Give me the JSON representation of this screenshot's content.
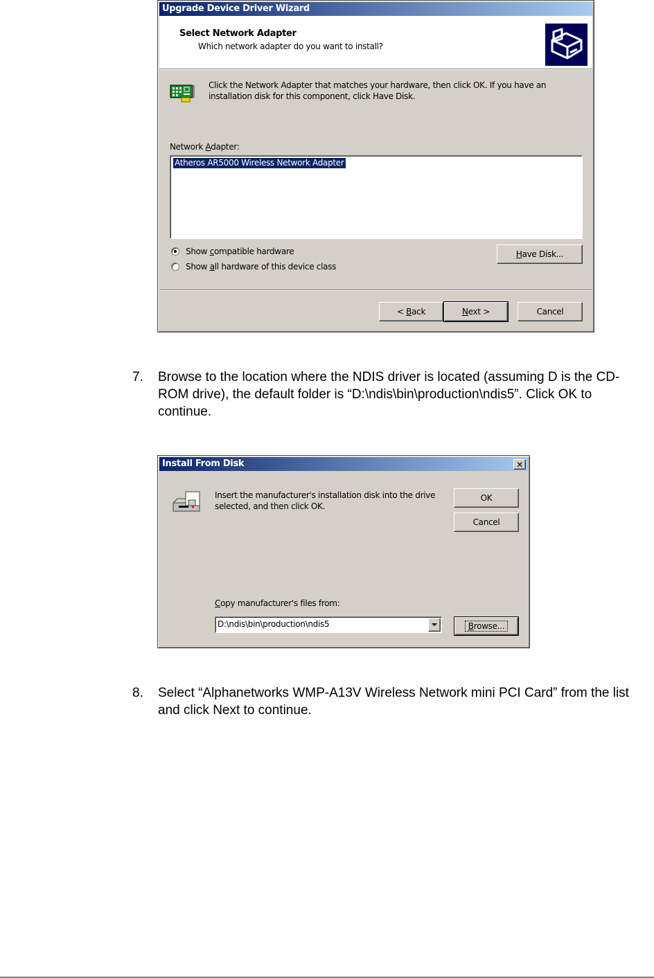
{
  "wizard": {
    "title": "Upgrade Device Driver Wizard",
    "header_title": "Select Network Adapter",
    "header_subtitle": "Which network adapter do you want to install?",
    "header_icon": "hardware-drawer-icon",
    "instruction": "Click the Network Adapter that matches your hardware, then click OK. If you have an installation disk for this component, click Have Disk.",
    "instruction_icon": "network-card-icon",
    "list_label_prefix": "Network ",
    "list_label_accel": "A",
    "list_label_suffix": "dapter:",
    "list_items": [
      {
        "label": "Atheros AR5000 Wireless Network Adapter",
        "selected": true
      }
    ],
    "radio_options": [
      {
        "prefix": "Show ",
        "accel": "c",
        "suffix": "ompatible hardware",
        "checked": true
      },
      {
        "prefix": "Show ",
        "accel": "a",
        "suffix": "ll hardware of this device class",
        "checked": false
      }
    ],
    "have_disk": {
      "accel": "H",
      "rest": "ave Disk..."
    },
    "back": {
      "prefix": "< ",
      "accel": "B",
      "rest": "ack"
    },
    "next": {
      "accel": "N",
      "rest": "ext >"
    },
    "cancel": "Cancel"
  },
  "steps": [
    {
      "number": "7.",
      "text": "Browse to the location where the NDIS driver is located (assuming D is the CD-ROM drive), the default folder is “D:\\ndis\\bin\\production\\ndis5”. Click OK to continue."
    },
    {
      "number": "8.",
      "text": "Select “Alphanetworks WMP-A13V Wireless Network mini PCI Card” from the list and click Next to continue."
    }
  ],
  "install_disk": {
    "title": "Install From Disk",
    "close_icon": "close-icon",
    "disk_icon": "floppy-drive-icon",
    "message": "Insert the manufacturer's installation disk into the drive selected, and then click OK.",
    "ok": "OK",
    "cancel": "Cancel",
    "copy_label_accel": "C",
    "copy_label_rest": "opy manufacturer's files from:",
    "path_value": "D:\\ndis\\bin\\production\\ndis5",
    "browse": {
      "accel": "B",
      "rest": "rowse..."
    }
  }
}
